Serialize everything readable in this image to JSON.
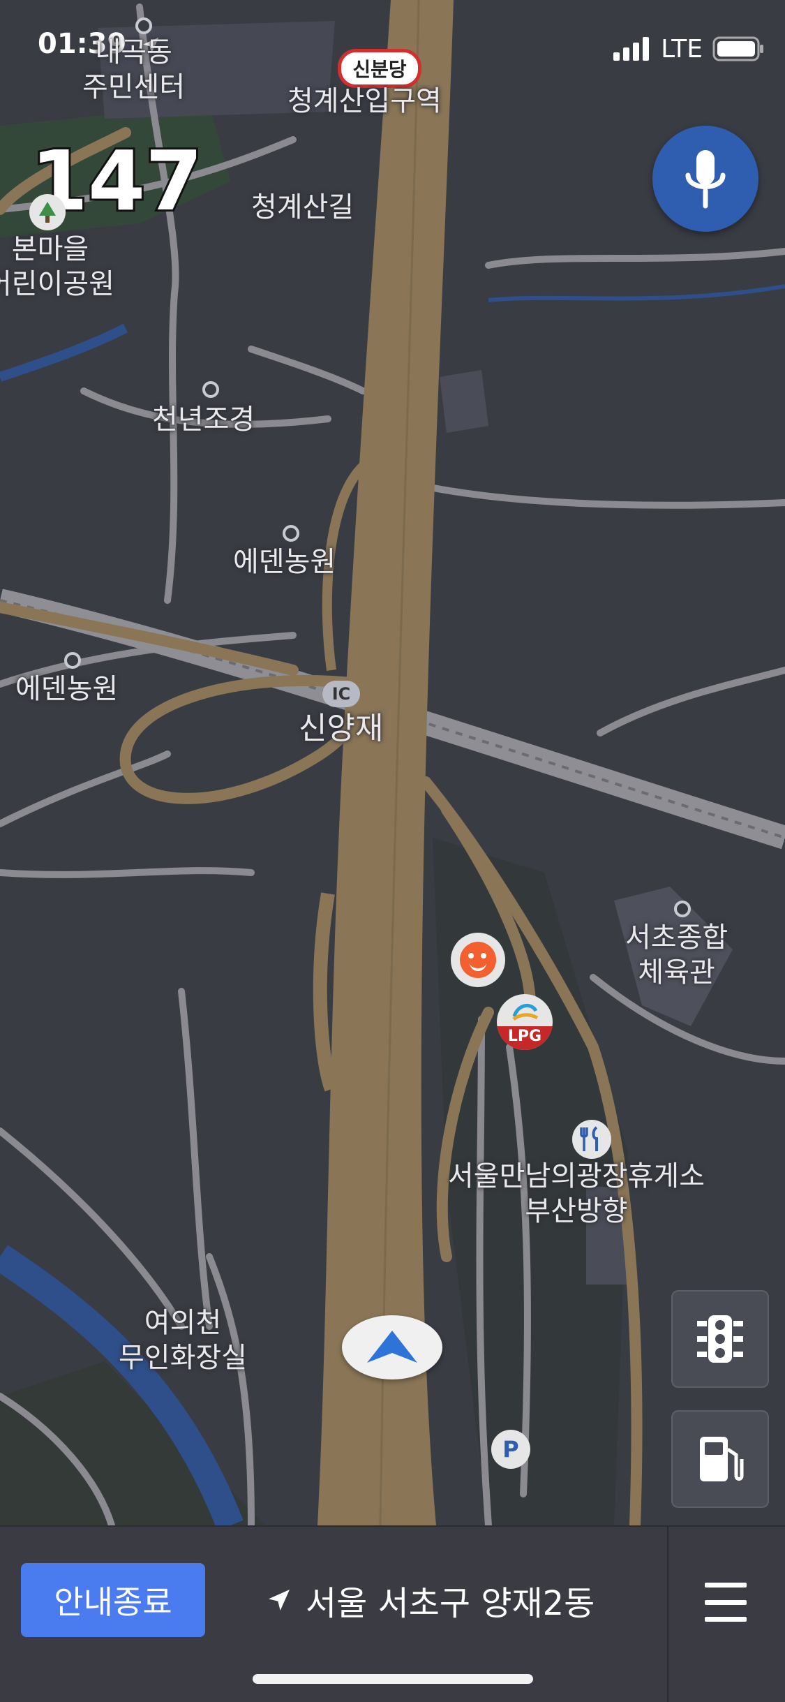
{
  "status_bar": {
    "time": "01:39",
    "network": "LTE"
  },
  "speed": "147",
  "metro_badge": "신분당",
  "ic_badge": "IC",
  "map_labels": [
    "내곡동\n주민센터",
    "청계산입구역",
    "청계산길",
    "본마을\n어린이공원",
    "천년조경",
    "에덴농원",
    "에덴농원",
    "신양재",
    "서초종합\n체육관",
    "서울만남의광장휴게소\n부산방향",
    "여의천\n무인화장실"
  ],
  "lpg_label": "LPG",
  "parking_label": "P",
  "bottom_bar": {
    "end_guidance_label": "안내종료",
    "current_address": "서울 서초구 양재2동"
  },
  "colors": {
    "road_major": "#8a7657",
    "map_bg": "#3a3c44",
    "accent_blue": "#4a7cf0",
    "mic_bg": "#2f5db0"
  },
  "icons": [
    "location-arrow-icon",
    "signal-icon",
    "battery-icon",
    "mic-icon",
    "traffic-light-icon",
    "gas-station-icon",
    "menu-icon",
    "navigation-arrow-icon",
    "restaurant-icon",
    "park-tree-icon"
  ]
}
